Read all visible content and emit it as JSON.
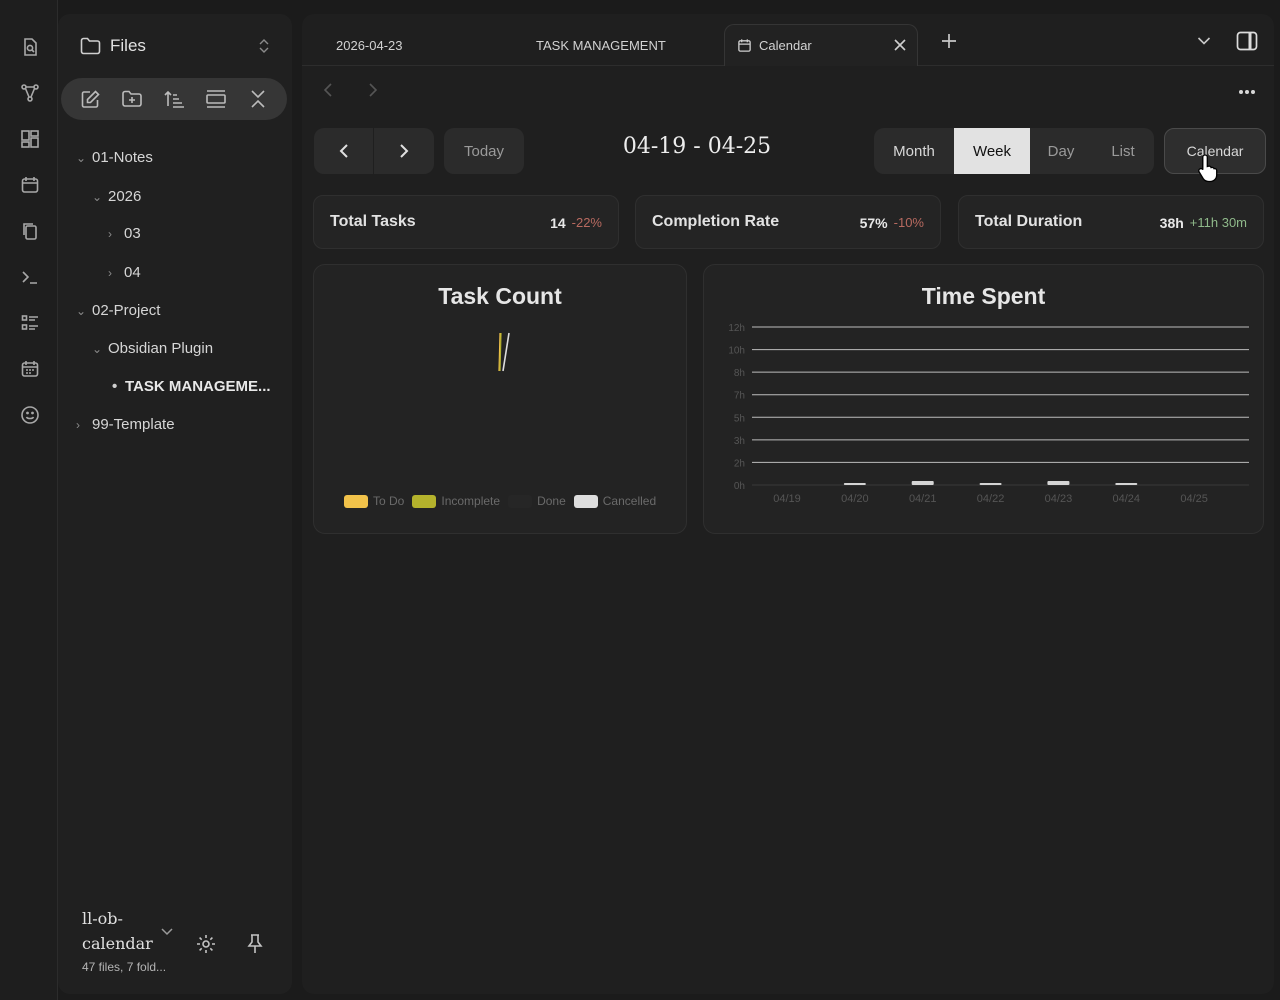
{
  "sidebar": {
    "title": "Files",
    "tree": {
      "notes": "01-Notes",
      "year": "2026",
      "m03": "03",
      "m04": "04",
      "project": "02-Project",
      "plugin": "Obsidian Plugin",
      "task": "TASK MANAGEME...",
      "template": "99-Template"
    },
    "vault_name": "ll-ob-calendar",
    "vault_count": "47 files, 7 fold..."
  },
  "tabs": {
    "t1": "2026-04-23",
    "t2": "TASK MANAGEMENT",
    "t3": "Calendar"
  },
  "calendar": {
    "today": "Today",
    "range": "04-19 - 04-25",
    "views": [
      "Month",
      "Week",
      "Day",
      "List"
    ],
    "selected_view": "Week",
    "calendar_btn": "Calendar"
  },
  "stats": [
    {
      "label": "Total Tasks",
      "value": "14",
      "delta": "-22%",
      "delta_color": "#b86a60"
    },
    {
      "label": "Completion Rate",
      "value": "57%",
      "delta": "-10%",
      "delta_color": "#b86a60"
    },
    {
      "label": "Total Duration",
      "value": "38h",
      "delta": "+11h 30m",
      "delta_color": "#8fb98a"
    }
  ],
  "chart_data": [
    {
      "type": "pie",
      "title": "Task Count",
      "legend": [
        "To Do",
        "Incomplete",
        "Done",
        "Cancelled"
      ],
      "colors": [
        "#f1c24a",
        "#b4b22c",
        "#262626",
        "#dddddd"
      ]
    },
    {
      "type": "bar",
      "title": "Time Spent",
      "categories": [
        "04/19",
        "04/20",
        "04/21",
        "04/22",
        "04/23",
        "04/24",
        "04/25"
      ],
      "y_ticks": [
        "12h",
        "10h",
        "8h",
        "7h",
        "5h",
        "3h",
        "2h",
        "0h"
      ],
      "values": [
        0,
        0.1,
        0.3,
        0.1,
        0.3,
        0.1,
        0
      ],
      "ylim": [
        0,
        12
      ],
      "grid": true
    }
  ]
}
